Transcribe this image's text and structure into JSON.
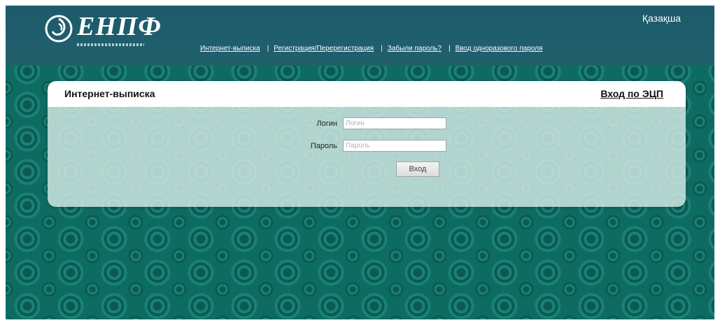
{
  "header": {
    "logo_text": "ЕНПФ",
    "language_link": "Қазақша",
    "nav": [
      {
        "label": "Интернет-выписка"
      },
      {
        "label": "Регистрация/Перерегистрация"
      },
      {
        "label": "Забыли пароль?"
      },
      {
        "label": "Ввод одноразового пароля"
      }
    ],
    "separator": "|"
  },
  "panel": {
    "title": "Интернет-выписка",
    "ecp_link": "Вход по ЭЦП",
    "login_label": "Логин",
    "login_placeholder": "Логин",
    "login_value": "",
    "password_label": "Пароль",
    "password_placeholder": "Пароль",
    "password_value": "",
    "submit_label": "Вход"
  },
  "colors": {
    "header": "#1f5e6c",
    "background": "#0e6b62",
    "panel_body": "#d6ece7"
  },
  "icons": [
    "logo-emblem-icon"
  ]
}
